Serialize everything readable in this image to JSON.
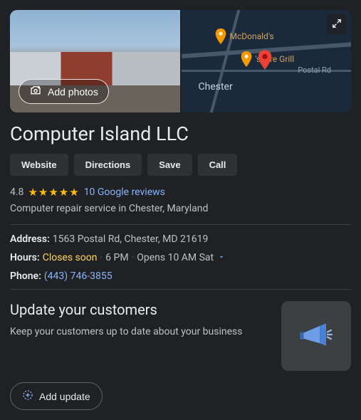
{
  "media": {
    "add_photos_label": "Add photos"
  },
  "map": {
    "city_label": "Chester",
    "road_label": "Postal Rd",
    "poi1": "McDonald's",
    "poi2": "'s Fire Grill"
  },
  "business": {
    "name": "Computer Island LLC",
    "description": "Computer repair service in Chester, Maryland"
  },
  "actions": {
    "website": "Website",
    "directions": "Directions",
    "save": "Save",
    "call": "Call"
  },
  "rating": {
    "value": "4.8",
    "stars": "★★★★★",
    "reviews_text": "10 Google reviews"
  },
  "info": {
    "address_label": "Address:",
    "address_value": "1563 Postal Rd, Chester, MD 21619",
    "hours_label": "Hours:",
    "hours_status": "Closes soon",
    "hours_close": "6 PM",
    "hours_open_next": "Opens 10 AM Sat",
    "phone_label": "Phone:",
    "phone_value": "(443) 746-3855"
  },
  "update": {
    "heading": "Update your customers",
    "blurb": "Keep your customers up to date about your business",
    "add_update_label": "Add update"
  }
}
